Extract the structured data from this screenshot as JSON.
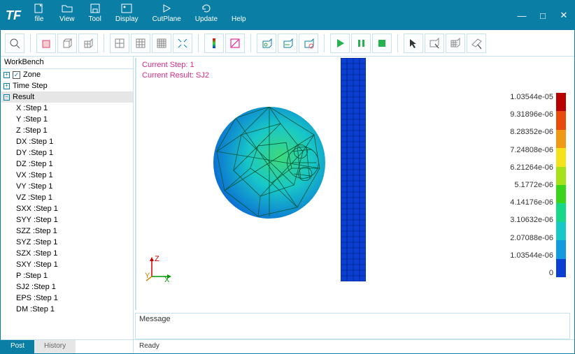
{
  "app": {
    "logo": "TF"
  },
  "winbuttons": {
    "min": "—",
    "max": "□",
    "close": "✕"
  },
  "menus": [
    {
      "label": "file"
    },
    {
      "label": "View"
    },
    {
      "label": "Tool"
    },
    {
      "label": "Display"
    },
    {
      "label": "CutPlane"
    },
    {
      "label": "Update"
    },
    {
      "label": "Help"
    }
  ],
  "workbench": {
    "title": "WorkBench"
  },
  "tree": {
    "zone_label": "Zone",
    "timestep_label": "Time Step",
    "result_label": "Result",
    "result_items": [
      "X :Step 1",
      "Y :Step 1",
      "Z :Step 1",
      "DX :Step 1",
      "DY :Step 1",
      "DZ :Step 1",
      "VX :Step 1",
      "VY :Step 1",
      "VZ :Step 1",
      "SXX :Step 1",
      "SYY :Step 1",
      "SZZ :Step 1",
      "SYZ :Step 1",
      "SZX :Step 1",
      "SXY :Step 1",
      "P :Step 1",
      "SJ2 :Step 1",
      "EPS :Step 1",
      "DM :Step 1"
    ]
  },
  "sidebar_tabs": {
    "post": "Post",
    "history": "History"
  },
  "viewport": {
    "step_line": "Current Step: 1",
    "result_line": "Current Result: SJ2",
    "axis": {
      "x": "X",
      "y": "Y",
      "z": "Z"
    }
  },
  "message": {
    "title": "Message"
  },
  "status": {
    "text": "Ready"
  },
  "legend": {
    "values": [
      "1.03544e-05",
      "9.31896e-06",
      "8.28352e-06",
      "7.24808e-06",
      "6.21264e-06",
      "5.1772e-06",
      "4.14176e-06",
      "3.10632e-06",
      "2.07088e-06",
      "1.03544e-06",
      "0"
    ],
    "colors": [
      "#b80000",
      "#e84c0d",
      "#f19915",
      "#f4e21a",
      "#a6e21a",
      "#3ad41a",
      "#17d888",
      "#18c8c8",
      "#149adf",
      "#0b3fd4"
    ]
  }
}
